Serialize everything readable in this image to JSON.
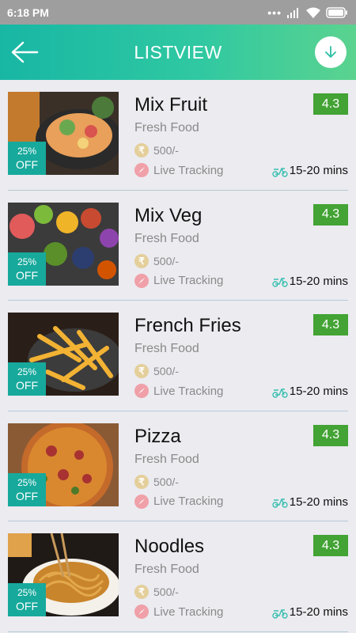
{
  "status": {
    "time": "6:18 PM",
    "icons": [
      "dots-icon",
      "signal-icon",
      "wifi-icon",
      "battery-icon"
    ]
  },
  "header": {
    "title": "LISTVIEW",
    "back_icon": "arrow-left-icon",
    "action_icon": "download-icon"
  },
  "colors": {
    "header_start": "#18b7a4",
    "header_end": "#5bd38f",
    "rating": "#43a334",
    "badge": "#17a99c"
  },
  "items": [
    {
      "name": "Mix Fruit",
      "subtitle": "Fresh Food",
      "price": "500/-",
      "tracking": "Live Tracking",
      "eta": "15-20 mins",
      "rating": "4.3",
      "discount_pct": "25%",
      "discount_off": "OFF"
    },
    {
      "name": "Mix Veg",
      "subtitle": "Fresh Food",
      "price": "500/-",
      "tracking": "Live Tracking",
      "eta": "15-20 mins",
      "rating": "4.3",
      "discount_pct": "25%",
      "discount_off": "OFF"
    },
    {
      "name": "French Fries",
      "subtitle": "Fresh Food",
      "price": "500/-",
      "tracking": "Live Tracking",
      "eta": "15-20 mins",
      "rating": "4.3",
      "discount_pct": "25%",
      "discount_off": "OFF"
    },
    {
      "name": "Pizza",
      "subtitle": "Fresh Food",
      "price": "500/-",
      "tracking": "Live Tracking",
      "eta": "15-20 mins",
      "rating": "4.3",
      "discount_pct": "25%",
      "discount_off": "OFF"
    },
    {
      "name": "Noodles",
      "subtitle": "Fresh Food",
      "price": "500/-",
      "tracking": "Live Tracking",
      "eta": "15-20 mins",
      "rating": "4.3",
      "discount_pct": "25%",
      "discount_off": "OFF"
    }
  ]
}
